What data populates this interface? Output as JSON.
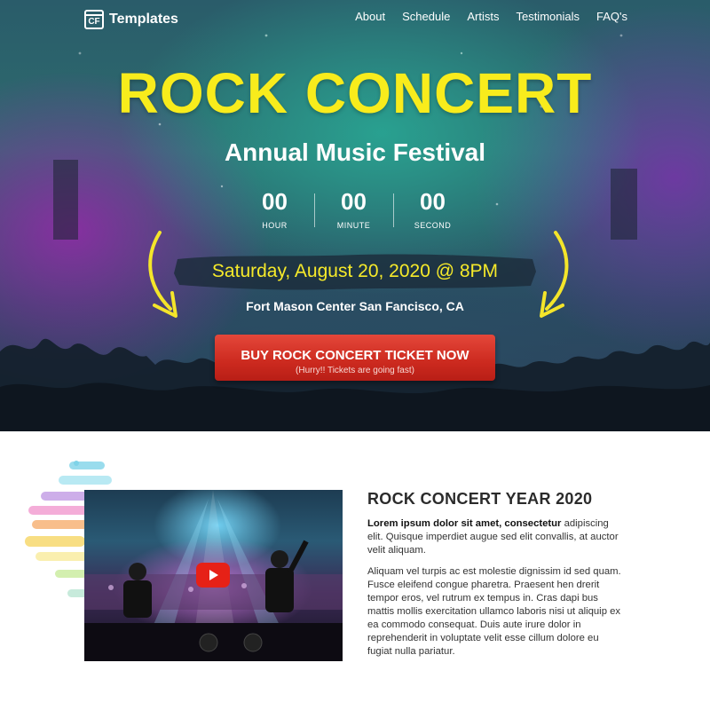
{
  "brand": {
    "logo_mark": "CF",
    "name": "Templates"
  },
  "nav": {
    "items": [
      "About",
      "Schedule",
      "Artists",
      "Testimonials",
      "FAQ's"
    ]
  },
  "hero": {
    "title": "ROCK CONCERT",
    "subtitle": "Annual Music Festival",
    "countdown": [
      {
        "value": "00",
        "label": "HOUR"
      },
      {
        "value": "00",
        "label": "MINUTE"
      },
      {
        "value": "00",
        "label": "SECOND"
      }
    ],
    "date": "Saturday, August 20, 2020 @ 8PM",
    "venue": "Fort Mason Center San Fancisco, CA",
    "cta": {
      "label": "BUY ROCK CONCERT TICKET NOW",
      "sublabel": "(Hurry!! Tickets are going fast)"
    }
  },
  "about": {
    "title": "ROCK CONCERT YEAR 2020",
    "para1_bold": "Lorem ipsum dolor sit amet, consectetur",
    "para1_rest": " adipiscing elit. Quisque imperdiet augue sed elit convallis, at auctor velit aliquam.",
    "para2": "Aliquam vel turpis ac est molestie dignissim id sed quam. Fusce eleifend congue pharetra. Praesent hen drerit tempor eros, vel rutrum ex tempus in. Cras dapi bus mattis mollis exercitation ullamco laboris nisi ut aliquip ex ea commodo consequat. Duis aute irure dolor in reprehenderit in voluptate velit esse cillum dolore eu fugiat nulla pariatur.",
    "video": {
      "play_icon": "youtube-play-icon"
    }
  },
  "colors": {
    "title_yellow": "#f8ec1c",
    "cta_red": "#d4291f",
    "play_red": "#e62117"
  }
}
